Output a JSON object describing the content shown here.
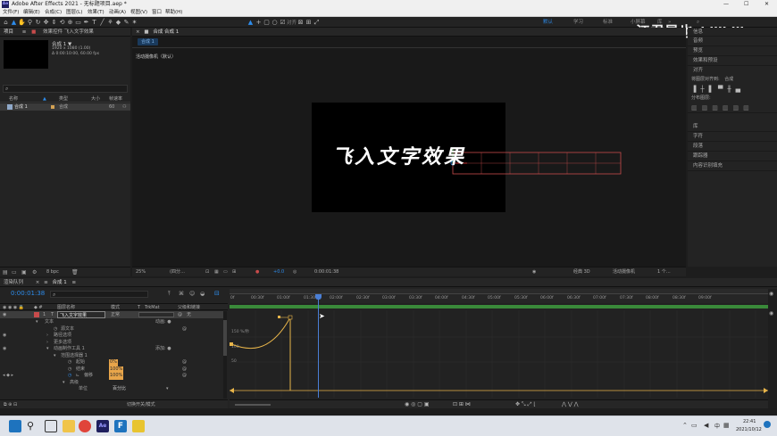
{
  "app": {
    "title": "Adobe After Effects 2021 - 无标题项目.aep *",
    "window_controls": [
      "—",
      "☐",
      "✕"
    ]
  },
  "menu": [
    "文件(F)",
    "编辑(E)",
    "合成(C)",
    "图层(L)",
    "效果(T)",
    "动画(A)",
    "视图(V)",
    "窗口",
    "帮助(H)"
  ],
  "toolbar": {
    "snap_label": "对齐",
    "workspaces": [
      "默认",
      "学习",
      "标准",
      "小屏幕",
      "库"
    ]
  },
  "watermark": {
    "text": "江君是也",
    "logo": "bilibili"
  },
  "project": {
    "tab_label": "项目",
    "effects_tab_label": "效果控件 飞入文字效果",
    "comp_name": "合成 1 ▼",
    "comp_info_1": "1920 x 1080 (1.00)",
    "comp_info_2": "Δ 0:00:10:00, 60.00 fps",
    "search_placeholder": "",
    "columns": [
      "名称",
      "类型",
      "大小",
      "帧速率"
    ],
    "items": [
      {
        "name": "合成 1",
        "type": "合成",
        "size": "",
        "fps": "60"
      }
    ],
    "bpc": "8 bpc"
  },
  "viewer": {
    "tab_label": "合成 合成 1",
    "sub_tab": "合成 1",
    "camera_label": "活动摄像机（默认）",
    "text": "飞入文字效果",
    "footer": {
      "zoom": "25%",
      "quality": "(四分…",
      "exposure": "+0.0",
      "timecode": "0:00:01:38",
      "renderer": "经典 3D",
      "camera": "活动摄像机",
      "views": "1 个…"
    }
  },
  "right_panel": {
    "header": "信息",
    "items": [
      "音频",
      "预览",
      "效果和预设",
      "对齐",
      "库",
      "字符",
      "段落",
      "跟踪器",
      "内容识别填充"
    ],
    "align_label": "将图层对齐到:",
    "align_target": "合成",
    "distribute_label": "分布图层:"
  },
  "timeline": {
    "render_queue_tab": "渲染队列",
    "comp_tab": "合成 1",
    "timecode": "0:00:01:38",
    "ruler": [
      "0f",
      "00:30f",
      "01:00f",
      "01:30f",
      "02:00f",
      "02:30f",
      "03:00f",
      "03:30f",
      "04:00f",
      "04:30f",
      "05:00f",
      "05:30f",
      "06:00f",
      "06:30f",
      "07:00f",
      "07:30f",
      "08:00f",
      "08:30f",
      "09:00f"
    ],
    "columns": {
      "name": "图层名称",
      "mode": "模式",
      "t": "T",
      "trkmat": "TrkMat",
      "parent": "父级和链接"
    },
    "layer": {
      "num": "1",
      "name": "飞入文字效果",
      "mode": "正常",
      "parent": "无"
    },
    "rows": [
      {
        "label": "文本",
        "indent": 1,
        "extra": "动画: ●"
      },
      {
        "label": "源文本",
        "indent": 3,
        "extra": ""
      },
      {
        "label": "路径选项",
        "indent": 2,
        "extra": ""
      },
      {
        "label": "更多选项",
        "indent": 2,
        "extra": ""
      },
      {
        "label": "动画制作工具 1",
        "indent": 2,
        "extra": "添加: ●"
      },
      {
        "label": "范围选择器 1",
        "indent": 3,
        "extra": ""
      },
      {
        "label": "起始",
        "indent": 4,
        "extra": "0%"
      },
      {
        "label": "结束",
        "indent": 4,
        "extra": "100%"
      },
      {
        "label": "偏移",
        "indent": 4,
        "extra": "100%"
      },
      {
        "label": "高级",
        "indent": 4,
        "extra": ""
      },
      {
        "label": "单位",
        "indent": 5,
        "extra": "百分比"
      }
    ],
    "graph_label_top": "150 %/秒",
    "graph_label_mid": "100",
    "graph_label_low": "50",
    "footer_label": "切换开关/模式"
  },
  "taskbar": {
    "time": "22:41",
    "date": "2021/10/12",
    "lang": "中"
  },
  "colors": {
    "accent_blue": "#2d8ceb",
    "playhead": "#4a7fd6",
    "curve": "#e8b54a",
    "layer_label": "#c84b4b"
  }
}
